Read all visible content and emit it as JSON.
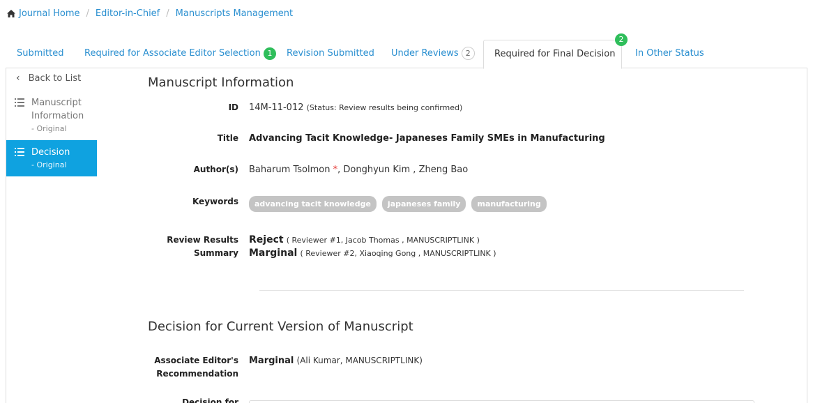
{
  "breadcrumb": {
    "home": "Journal Home",
    "editor": "Editor-in-Chief",
    "manuscripts": "Manuscripts Management"
  },
  "tabs": [
    {
      "label": "Submitted"
    },
    {
      "label": "Required for Associate Editor Selection",
      "badge": "1"
    },
    {
      "label": "Revision Submitted"
    },
    {
      "label": "Under Reviews",
      "badge": "2"
    },
    {
      "label": "Required for Final Decision",
      "badge": "2"
    },
    {
      "label": "In Other Status"
    }
  ],
  "sidebar": {
    "back": "Back to List",
    "items": [
      {
        "label": "Manuscript Information",
        "sub": "- Original"
      },
      {
        "label": "Decision",
        "sub": "- Original"
      }
    ]
  },
  "manuscript": {
    "heading": "Manuscript Information",
    "id_label": "ID",
    "id_value": "14M-11-012",
    "status": "(Status: Review results being confirmed)",
    "title_label": "Title",
    "title_value": "Advancing Tacit Knowledge- Japaneses Family SMEs in Manufacturing",
    "authors_label": "Author(s)",
    "author_primary": "Baharum Tsolmon",
    "author_star": "*",
    "authors_rest": ", Donghyun Kim , Zheng Bao",
    "keywords_label": "Keywords",
    "keywords": [
      "advancing tacit knowledge",
      "japaneses family",
      "manufacturing"
    ],
    "review_label": "Review Results Summary",
    "reviews": [
      {
        "verdict": "Reject",
        "detail": "( Reviewer #1, Jacob Thomas , MANUSCRIPTLINK )"
      },
      {
        "verdict": "Marginal",
        "detail": "( Reviewer #2, Xiaoqing Gong , MANUSCRIPTLINK )"
      }
    ]
  },
  "decision": {
    "heading": "Decision for Current Version of Manuscript",
    "ae_label": "Associate Editor's Recommendation",
    "ae_verdict": "Marginal",
    "ae_detail": "(Ali Kumar, MANUSCRIPTLINK)",
    "decision_label": "Decision for"
  },
  "colors": {
    "link": "#2a8fd0",
    "active_nav": "#0fa2e0",
    "badge_green": "#2fbe5b",
    "tag_gray": "#c4c4c4",
    "required_star": "#e53935"
  }
}
